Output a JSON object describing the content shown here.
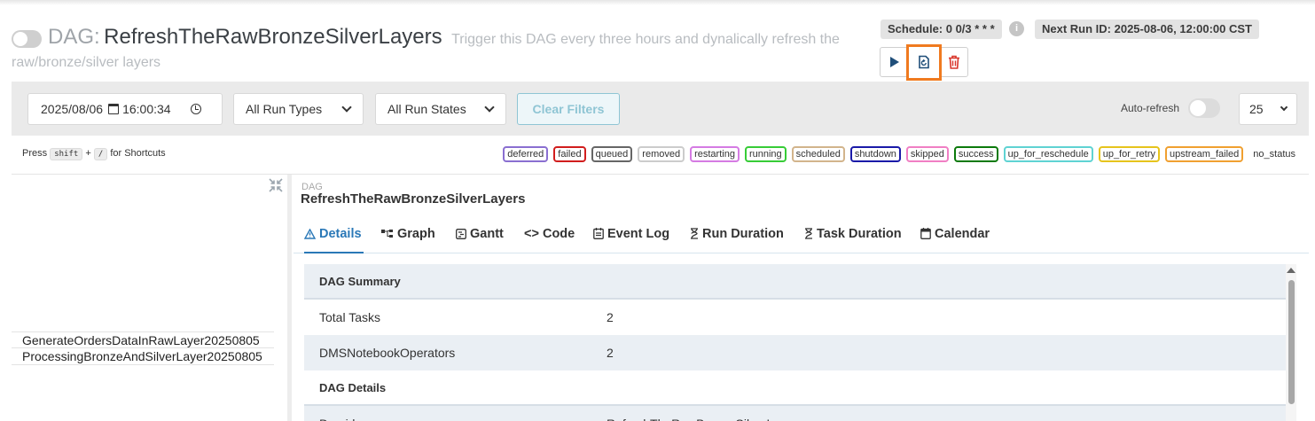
{
  "header": {
    "dag_prefix": "DAG:",
    "dag_name": "RefreshTheRawBronzeSilverLayers",
    "description_line1": "Trigger this DAG every three hours and dynalically refresh the",
    "description_line2": "raw/bronze/silver layers",
    "schedule": "Schedule: 0 0/3 * * *",
    "info_icon": "i",
    "next_run": "Next Run ID: 2025-08-06, 12:00:00 CST"
  },
  "actions": {
    "trigger_icon": "play-icon",
    "reparse_icon": "reparse-icon",
    "delete_icon": "trash-icon",
    "highlight_color": "#f07a1f"
  },
  "filters": {
    "date": "2025/08/06",
    "time": "16:00:34",
    "run_types": "All Run Types",
    "run_states": "All Run States",
    "clear": "Clear Filters",
    "auto_refresh": "Auto-refresh",
    "page_size": "25"
  },
  "shortcuts": {
    "press": "Press",
    "key1": "shift",
    "plus": "+",
    "key2": "/",
    "for": "for Shortcuts"
  },
  "legend": [
    {
      "label": "deferred",
      "color": "#8a6fd1"
    },
    {
      "label": "failed",
      "color": "#d11d1d"
    },
    {
      "label": "queued",
      "color": "#666666"
    },
    {
      "label": "removed",
      "color": "#cccccc"
    },
    {
      "label": "restarting",
      "color": "#d57be3"
    },
    {
      "label": "running",
      "color": "#37cc37"
    },
    {
      "label": "scheduled",
      "color": "#d2b48c"
    },
    {
      "label": "shutdown",
      "color": "#1a1aa8"
    },
    {
      "label": "skipped",
      "color": "#f07fc4"
    },
    {
      "label": "success",
      "color": "#0c7a0c"
    },
    {
      "label": "up_for_reschedule",
      "color": "#5fd3d3"
    },
    {
      "label": "up_for_retry",
      "color": "#e6c41c"
    },
    {
      "label": "upstream_failed",
      "color": "#f0a030"
    },
    {
      "label": "no_status",
      "color": ""
    }
  ],
  "tasks": [
    "GenerateOrdersDataInRawLayer20250805",
    "ProcessingBronzeAndSilverLayer20250805"
  ],
  "detail": {
    "label": "DAG",
    "title": "RefreshTheRawBronzeSilverLayers",
    "tabs": [
      "Details",
      "Graph",
      "Gantt",
      "Code",
      "Event Log",
      "Run Duration",
      "Task Duration",
      "Calendar"
    ],
    "summary_header": "DAG Summary",
    "rows": [
      {
        "key": "Total Tasks",
        "value": "2"
      },
      {
        "key": "DMSNotebookOperators",
        "value": "2"
      }
    ],
    "details_header": "DAG Details",
    "partial_key": "Dag id",
    "partial_value": "RefreshTheRawBronzeSilverLayers"
  }
}
